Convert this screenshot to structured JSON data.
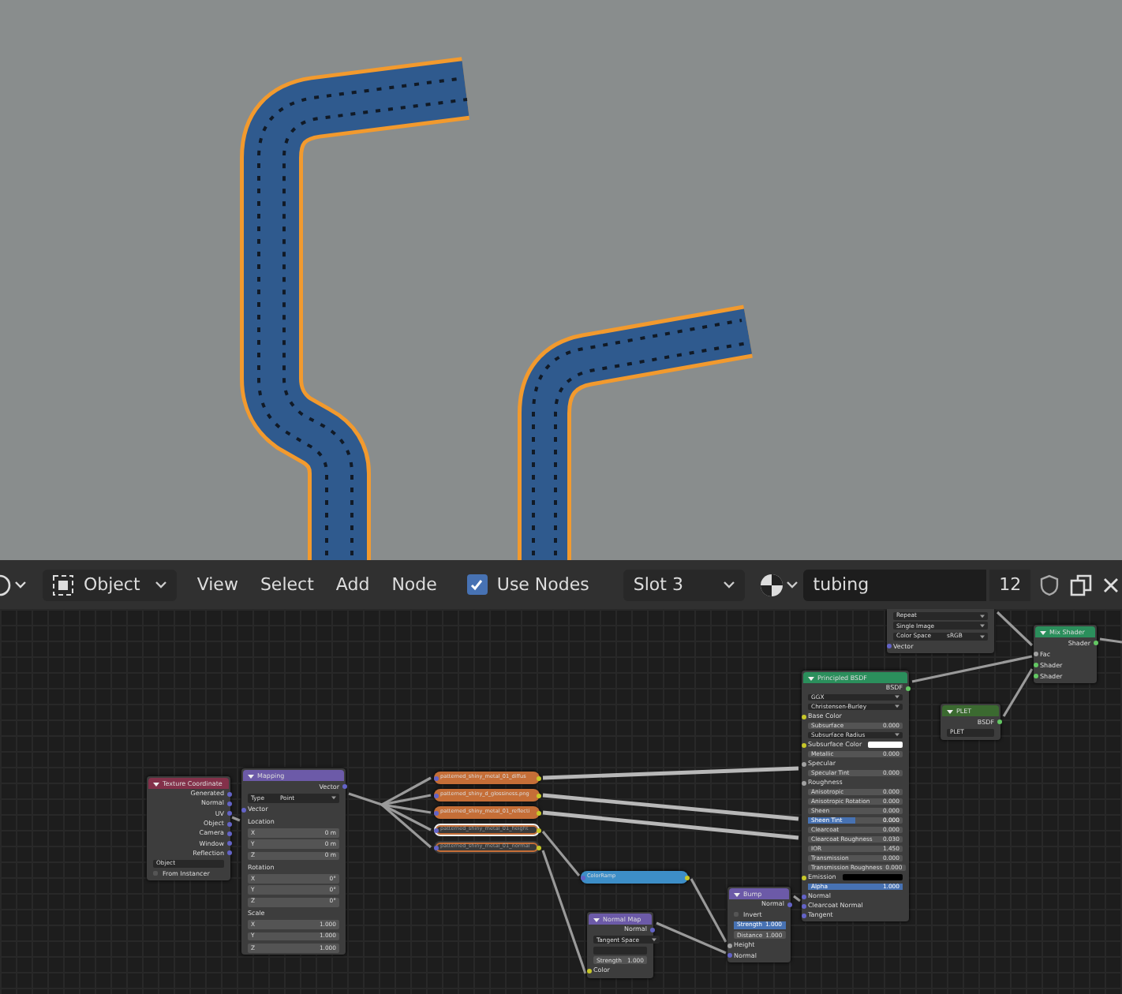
{
  "header": {
    "object_type": "Object",
    "menus": [
      "View",
      "Select",
      "Add",
      "Node"
    ],
    "use_nodes": {
      "label": "Use Nodes",
      "checked": true
    },
    "slot": "Slot 3",
    "material": {
      "name": "tubing",
      "users": "12"
    }
  },
  "nodes": [
    {
      "kind": "partial",
      "selected": false,
      "muted": false,
      "rows": [
        {
          "kind": "dropdown",
          "label": "Repeat"
        },
        {
          "kind": "dropdown",
          "label": "Single Image"
        },
        {
          "kind": "dropdown",
          "label": "Color Space",
          "value": "sRGB"
        },
        {
          "kind": "input",
          "label": "Vector",
          "color": "#6363c7"
        }
      ]
    },
    {
      "kind": "full",
      "color": "#2b8f5c",
      "title": "Mix Shader",
      "selected": false,
      "muted": false,
      "rows": [
        {
          "kind": "output",
          "label": "Shader",
          "color": "#63c763"
        },
        {
          "kind": "input",
          "label": "Fac",
          "color": "#a1a1a1"
        },
        {
          "kind": "input",
          "label": "Shader",
          "color": "#63c763"
        },
        {
          "kind": "input",
          "label": "Shader",
          "color": "#63c763"
        }
      ]
    },
    {
      "kind": "full",
      "color": "#2b8f5c",
      "title": "Principled BSDF",
      "selected": false,
      "muted": false,
      "rows": [
        {
          "kind": "output",
          "label": "BSDF",
          "color": "#63c763"
        },
        {
          "kind": "dropdown",
          "label": "GGX"
        },
        {
          "kind": "dropdown",
          "label": "Christensen-Burley"
        },
        {
          "kind": "input",
          "label": "Base Color",
          "color": "#c7c729"
        },
        {
          "kind": "value",
          "label": "Subsurface",
          "value": "0.000"
        },
        {
          "kind": "dropdown",
          "label": "Subsurface Radius"
        },
        {
          "kind": "swatch",
          "label": "Subsurface Color",
          "color": "#ffffff"
        },
        {
          "kind": "value",
          "label": "Metallic",
          "value": "0.000"
        },
        {
          "kind": "input",
          "label": "Specular",
          "color": "#a1a1a1"
        },
        {
          "kind": "value",
          "label": "Specular Tint",
          "value": "0.000"
        },
        {
          "kind": "input",
          "label": "Roughness",
          "color": "#a1a1a1"
        },
        {
          "kind": "value",
          "label": "Anisotropic",
          "value": "0.000"
        },
        {
          "kind": "value",
          "label": "Anisotropic Rotation",
          "value": "0.000"
        },
        {
          "kind": "value",
          "label": "Sheen",
          "value": "0.000"
        },
        {
          "kind": "slider",
          "label": "Sheen Tint",
          "value": "0.000",
          "level": 0.5
        },
        {
          "kind": "value",
          "label": "Clearcoat",
          "value": "0.000"
        },
        {
          "kind": "value",
          "label": "Clearcoat Roughness",
          "value": "0.030"
        },
        {
          "kind": "value",
          "label": "IOR",
          "value": "1.450"
        },
        {
          "kind": "value",
          "label": "Transmission",
          "value": "0.000"
        },
        {
          "kind": "value",
          "label": "Transmission Roughness",
          "value": "0.000"
        },
        {
          "kind": "swatch",
          "label": "Emission",
          "color": "#000000"
        },
        {
          "kind": "slider",
          "label": "Alpha",
          "value": "1.000",
          "level": 1
        },
        {
          "kind": "input",
          "label": "Normal",
          "color": "#6363c7"
        },
        {
          "kind": "input",
          "label": "Clearcoat Normal",
          "color": "#6363c7"
        },
        {
          "kind": "input",
          "label": "Tangent",
          "color": "#6363c7"
        }
      ]
    },
    {
      "kind": "full",
      "color": "#3b6a30",
      "title": "PLET",
      "selected": false,
      "muted": false,
      "rows": [
        {
          "kind": "output",
          "label": "BSDF",
          "color": "#63c763"
        },
        {
          "kind": "field",
          "label": "PLET"
        }
      ]
    },
    {
      "kind": "full",
      "color": "#83314a",
      "title": "Texture Coordinate",
      "selected": false,
      "muted": false,
      "rows": [
        {
          "kind": "output",
          "label": "Generated",
          "color": "#6363c7"
        },
        {
          "kind": "output",
          "label": "Normal",
          "color": "#6363c7"
        },
        {
          "kind": "output",
          "label": "UV",
          "color": "#6363c7"
        },
        {
          "kind": "output",
          "label": "Object",
          "color": "#6363c7"
        },
        {
          "kind": "output",
          "label": "Camera",
          "color": "#6363c7"
        },
        {
          "kind": "output",
          "label": "Window",
          "color": "#6363c7"
        },
        {
          "kind": "output",
          "label": "Reflection",
          "color": "#6363c7"
        },
        {
          "kind": "field",
          "label": "Object"
        },
        {
          "kind": "check",
          "label": "From Instancer",
          "checked": false
        }
      ]
    },
    {
      "kind": "full",
      "color": "#6c5aa8",
      "title": "Mapping",
      "selected": false,
      "muted": false,
      "rows": [
        {
          "kind": "output",
          "label": "Vector",
          "color": "#6363c7"
        },
        {
          "kind": "dropdown",
          "label": "Type",
          "value": "Point"
        },
        {
          "kind": "input",
          "label": "Vector",
          "color": "#6363c7"
        },
        {
          "kind": "section",
          "label": "Location"
        },
        {
          "kind": "value",
          "label": "X",
          "value": "0 m"
        },
        {
          "kind": "value",
          "label": "Y",
          "value": "0 m"
        },
        {
          "kind": "value",
          "label": "Z",
          "value": "0 m"
        },
        {
          "kind": "section",
          "label": "Rotation"
        },
        {
          "kind": "value",
          "label": "X",
          "value": "0°"
        },
        {
          "kind": "value",
          "label": "Y",
          "value": "0°"
        },
        {
          "kind": "value",
          "label": "Z",
          "value": "0°"
        },
        {
          "kind": "section",
          "label": "Scale"
        },
        {
          "kind": "value",
          "label": "X",
          "value": "1.000"
        },
        {
          "kind": "value",
          "label": "Y",
          "value": "1.000"
        },
        {
          "kind": "value",
          "label": "Z",
          "value": "1.000"
        }
      ]
    },
    {
      "kind": "collapsed",
      "color": "#c56e37",
      "title": "patterned_shiny_metal_01_diffus",
      "selected": false,
      "muted": false
    },
    {
      "kind": "collapsed",
      "color": "#c56e37",
      "title": "patterned_shiny_d_glossiness.png",
      "selected": false,
      "muted": false
    },
    {
      "kind": "collapsed",
      "color": "#c56e37",
      "title": "patterned_shiny_metal_01_reflecti",
      "selected": false,
      "muted": false
    },
    {
      "kind": "collapsed",
      "color": "#c56e37",
      "title": "patterned_shiny_metal_01_height",
      "selected": true,
      "muted": true
    },
    {
      "kind": "collapsed",
      "color": "#c56e37",
      "title": "patterned_shiny_metal_01_normal",
      "selected": false,
      "muted": true
    },
    {
      "kind": "collapsed",
      "color": "#3d8ec7",
      "title": "ColorRamp",
      "selected": false,
      "muted": false
    },
    {
      "kind": "full",
      "color": "#6c5aa8",
      "title": "Normal Map",
      "selected": false,
      "muted": false,
      "rows": [
        {
          "kind": "output",
          "label": "Normal",
          "color": "#6363c7"
        },
        {
          "kind": "dropdown",
          "label": "Tangent Space"
        },
        {
          "kind": "field"
        },
        {
          "kind": "value",
          "label": "Strength",
          "value": "1.000"
        },
        {
          "kind": "input",
          "label": "Color",
          "color": "#c7c729"
        }
      ]
    },
    {
      "kind": "full",
      "color": "#6c5aa8",
      "title": "Bump",
      "selected": false,
      "muted": false,
      "rows": [
        {
          "kind": "output",
          "label": "Normal",
          "color": "#6363c7"
        },
        {
          "kind": "check",
          "label": "Invert",
          "checked": false
        },
        {
          "kind": "slider",
          "label": "Strength",
          "value": "1.000",
          "level": 1
        },
        {
          "kind": "value",
          "label": "Distance",
          "value": "1.000"
        },
        {
          "kind": "input",
          "label": "Height",
          "color": "#a1a1a1"
        },
        {
          "kind": "input",
          "label": "Normal",
          "color": "#6363c7"
        }
      ]
    }
  ]
}
